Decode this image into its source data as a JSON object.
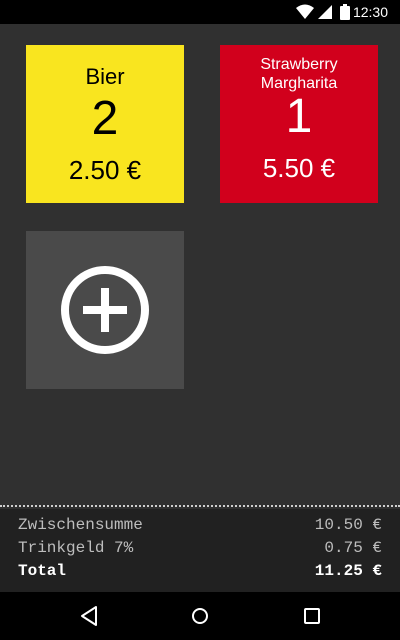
{
  "status_bar": {
    "time": "12:30",
    "icons": [
      "wifi-icon",
      "signal-icon",
      "battery-icon"
    ]
  },
  "tiles": [
    {
      "name": "Bier",
      "quantity": "2",
      "price": "2.50 €",
      "color": "#f9e51f"
    },
    {
      "name": "Strawberry\nMargharita",
      "name_line1": "Strawberry",
      "name_line2": "Margharita",
      "quantity": "1",
      "price": "5.50 €",
      "color": "#d1001c"
    }
  ],
  "add_tile": {
    "icon": "plus-circle-icon"
  },
  "totals": {
    "subtotal_label": "Zwischensumme",
    "subtotal_value": "10.50 €",
    "tip_label": "Trinkgeld 7%",
    "tip_value": "0.75 €",
    "total_label": "Total",
    "total_value": "11.25 €"
  },
  "nav_bar": {
    "buttons": [
      "back-icon",
      "home-icon",
      "recents-icon"
    ]
  }
}
